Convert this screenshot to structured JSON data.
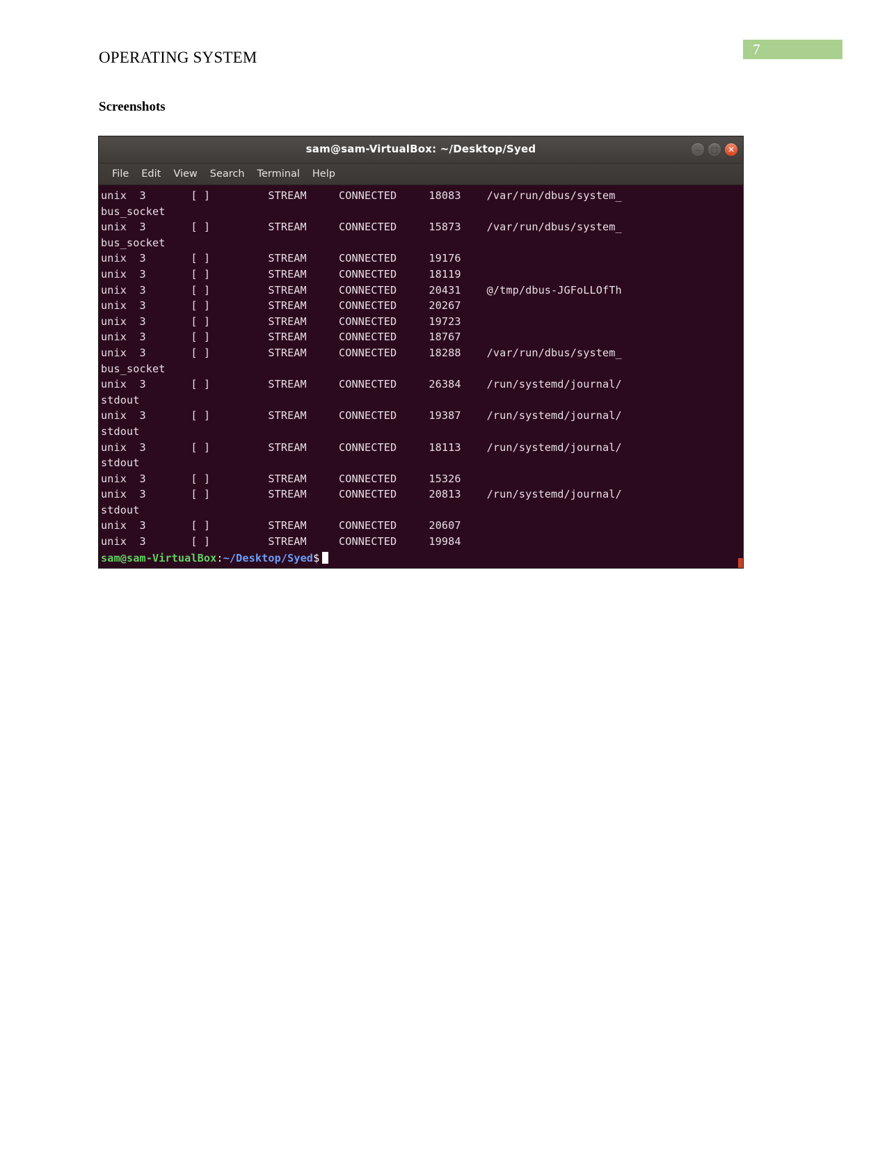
{
  "document": {
    "page_number": "7",
    "header": "OPERATING SYSTEM",
    "subheading": "Screenshots",
    "page_band_color": "#a9d08e"
  },
  "terminal": {
    "title": "sam@sam-VirtualBox: ~/Desktop/Syed",
    "window_buttons": {
      "minimize": "‒",
      "maximize": "□",
      "close": "✕"
    },
    "menu": [
      "File",
      "Edit",
      "View",
      "Search",
      "Terminal",
      "Help"
    ],
    "background_color": "#2c0a1e",
    "foreground_color": "#e8dfe4",
    "lines": [
      "unix  3       [ ]         STREAM     CONNECTED     18083    /var/run/dbus/system_",
      "bus_socket",
      "unix  3       [ ]         STREAM     CONNECTED     15873    /var/run/dbus/system_",
      "bus_socket",
      "unix  3       [ ]         STREAM     CONNECTED     19176",
      "unix  3       [ ]         STREAM     CONNECTED     18119",
      "unix  3       [ ]         STREAM     CONNECTED     20431    @/tmp/dbus-JGFoLLOfTh",
      "unix  3       [ ]         STREAM     CONNECTED     20267",
      "unix  3       [ ]         STREAM     CONNECTED     19723",
      "unix  3       [ ]         STREAM     CONNECTED     18767",
      "unix  3       [ ]         STREAM     CONNECTED     18288    /var/run/dbus/system_",
      "bus_socket",
      "unix  3       [ ]         STREAM     CONNECTED     26384    /run/systemd/journal/",
      "stdout",
      "unix  3       [ ]         STREAM     CONNECTED     19387    /run/systemd/journal/",
      "stdout",
      "unix  3       [ ]         STREAM     CONNECTED     18113    /run/systemd/journal/",
      "stdout",
      "unix  3       [ ]         STREAM     CONNECTED     15326",
      "unix  3       [ ]         STREAM     CONNECTED     20813    /run/systemd/journal/",
      "stdout",
      "unix  3       [ ]         STREAM     CONNECTED     20607",
      "unix  3       [ ]         STREAM     CONNECTED     19984"
    ],
    "prompt": {
      "user_host": "sam@sam-VirtualBox",
      "separator": ":",
      "path": "~/Desktop/Syed",
      "symbol": "$",
      "user_host_color": "#61d160",
      "path_color": "#6a9df8"
    }
  }
}
